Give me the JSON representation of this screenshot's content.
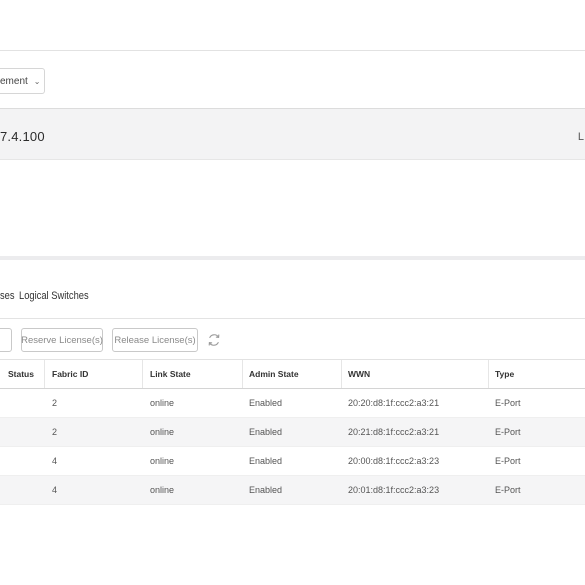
{
  "management_dropdown": {
    "label": "ement",
    "chevron_icon": "chevron-down-icon"
  },
  "switch_bar": {
    "ip": "7.4.100",
    "right_label": "L"
  },
  "tabs": [
    {
      "label": "ses"
    },
    {
      "label": "Logical Switches"
    }
  ],
  "toolbar": {
    "partial_button_label": "",
    "reserve_label": "Reserve License(s)",
    "release_label": "Release License(s)",
    "refresh_icon": "refresh-icon"
  },
  "table": {
    "headers": {
      "status": "Status",
      "fabric_id": "Fabric ID",
      "link_state": "Link State",
      "admin_state": "Admin State",
      "wwn": "WWN",
      "type": "Type"
    },
    "rows": [
      {
        "status": "",
        "fabric_id": "2",
        "link_state": "online",
        "admin_state": "Enabled",
        "wwn": "20:20:d8:1f:ccc2:a3:21",
        "type": "E-Port"
      },
      {
        "status": "",
        "fabric_id": "2",
        "link_state": "online",
        "admin_state": "Enabled",
        "wwn": "20:21:d8:1f:ccc2:a3:21",
        "type": "E-Port"
      },
      {
        "status": "",
        "fabric_id": "4",
        "link_state": "online",
        "admin_state": "Enabled",
        "wwn": "20:00:d8:1f:ccc2:a3:23",
        "type": "E-Port"
      },
      {
        "status": "",
        "fabric_id": "4",
        "link_state": "online",
        "admin_state": "Enabled",
        "wwn": "20:01:d8:1f:ccc2:a3:23",
        "type": "E-Port"
      }
    ]
  }
}
